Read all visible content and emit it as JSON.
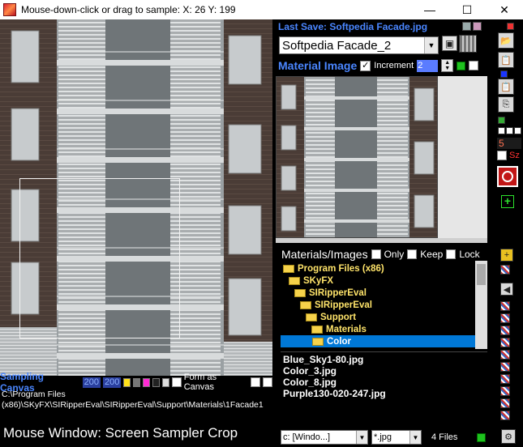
{
  "window": {
    "title": "Mouse-down-click or drag to sample: X: 26  Y: 199",
    "minimize_glyph": "—",
    "maximize_glyph": "☐",
    "close_glyph": "✕"
  },
  "right_panel": {
    "last_save": "Last Save: Softpedia Facade.jpg",
    "material_name": "Softpedia Facade_2",
    "material_image_label": "Material Image",
    "material_image_checked": true,
    "increment_label": "Increment",
    "increment_value": "2"
  },
  "toolbar": {
    "value_5": "5",
    "sz_label": "Sz",
    "plus_glyph": "+"
  },
  "sampling": {
    "label": "Sampling Canvas",
    "width": "200",
    "height": "200",
    "form_as_canvas_label": "Form as Canvas",
    "path_line1": "C:\\Program Files",
    "path_line2": "(x86)\\SKyFX\\SIRipperEval\\SIRipperEval\\Support\\Materials\\1Facade1",
    "mouse_window": "Mouse Window: Screen Sampler Crop"
  },
  "materials": {
    "label": "Materials/Images",
    "only_label": "Only",
    "keep_label": "Keep",
    "lock_label": "Lock",
    "tree": [
      {
        "label": "Program Files (x86)",
        "indent": 0,
        "selected": false
      },
      {
        "label": "SKyFX",
        "indent": 1,
        "selected": false
      },
      {
        "label": "SIRipperEval",
        "indent": 2,
        "selected": false
      },
      {
        "label": "SIRipperEval",
        "indent": 3,
        "selected": false
      },
      {
        "label": "Support",
        "indent": 4,
        "selected": false
      },
      {
        "label": "Materials",
        "indent": 5,
        "selected": false
      },
      {
        "label": "Color",
        "indent": 6,
        "selected": true
      }
    ],
    "files": [
      "Blue_Sky1-80.jpg",
      "Color_3.jpg",
      "Color_8.jpg",
      "Purple130-020-247.jpg"
    ],
    "drive": "c: [Windo...]",
    "filter": "*.jpg",
    "files_count": "4 Files"
  },
  "colors": {
    "accent_blue": "#4a86ff",
    "selection": "#0078d7",
    "folder_text": "#ffe46a"
  }
}
